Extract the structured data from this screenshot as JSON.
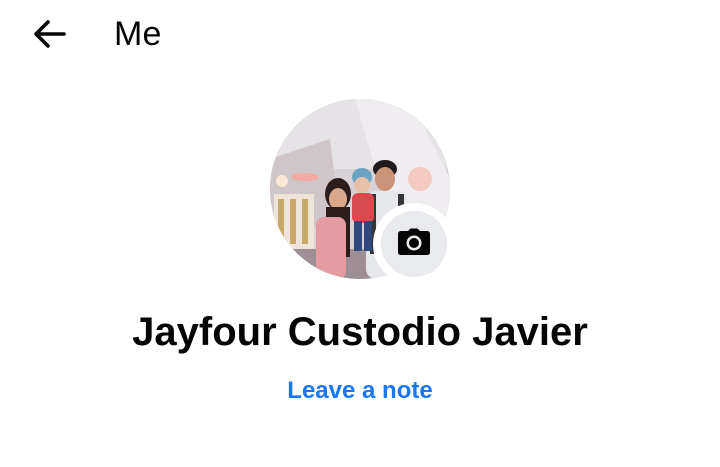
{
  "header": {
    "back_icon": "arrow-left-icon",
    "title": "Me"
  },
  "profile": {
    "avatar_description_icon": "profile-photo",
    "camera_icon": "camera-icon",
    "name": "Jayfour Custodio Javier",
    "note_link": "Leave a note"
  },
  "colors": {
    "text": "#050505",
    "link": "#1877f2",
    "camera_bg": "#e9eaed",
    "background": "#ffffff"
  }
}
